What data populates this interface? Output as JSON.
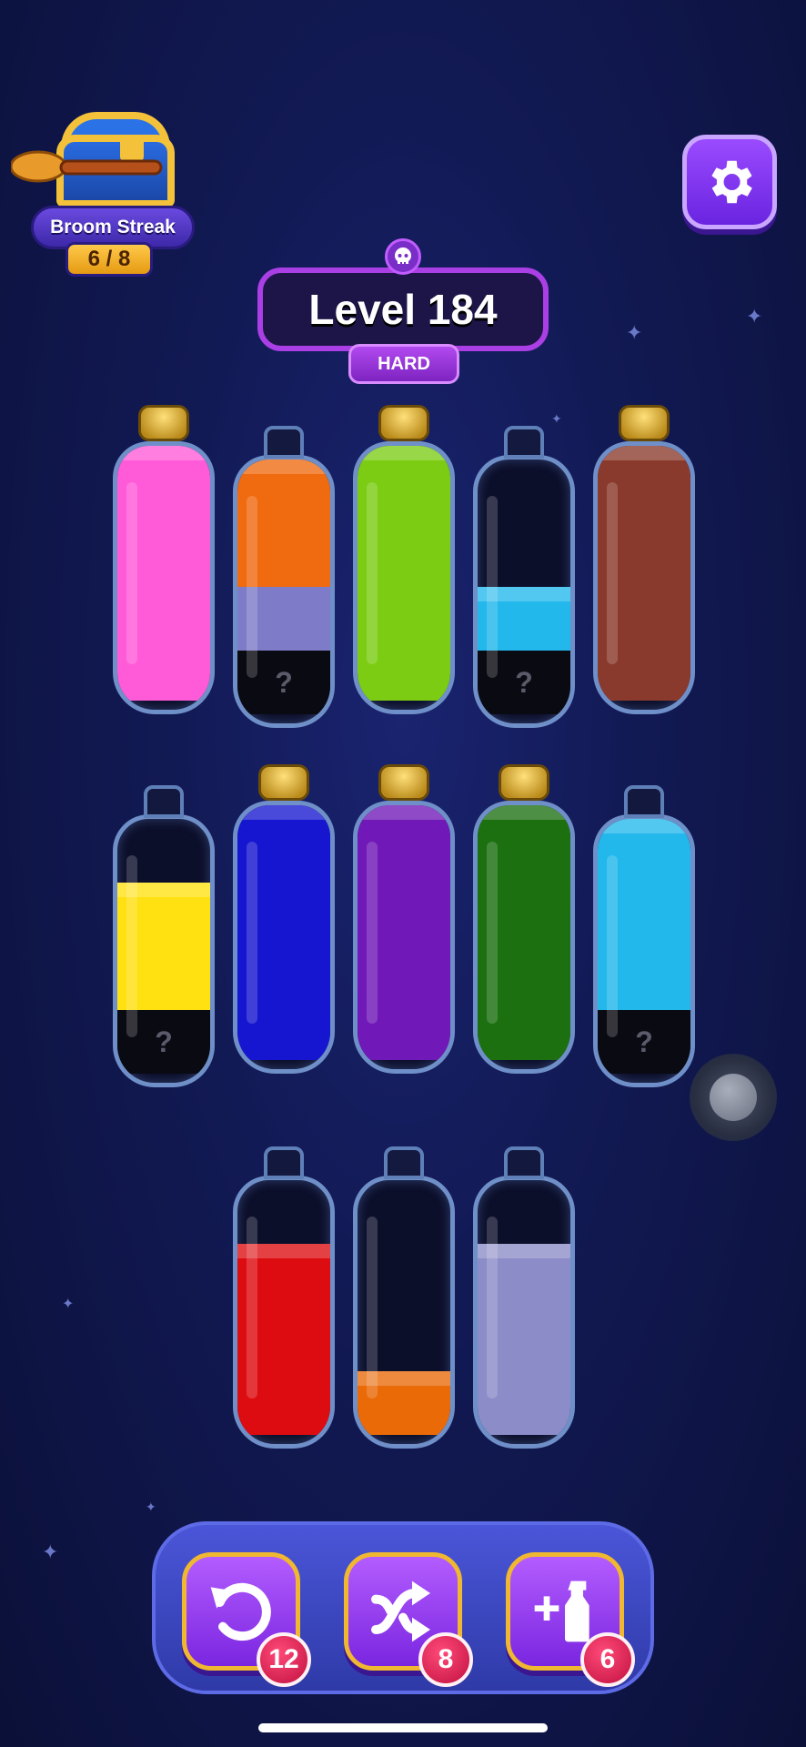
{
  "streak": {
    "label": "Broom Streak",
    "count": "6 / 8"
  },
  "level": {
    "title": "Level 184",
    "difficulty": "HARD"
  },
  "hidden_mark": "?",
  "tubes": [
    {
      "cork": true,
      "segments": [
        {
          "color": "#ff5ad8",
          "units": 4
        }
      ]
    },
    {
      "cork": false,
      "segments": [
        {
          "hidden": true
        },
        {
          "color": "#7e7cc8",
          "units": 1
        },
        {
          "color": "#f06a10",
          "units": 2
        }
      ]
    },
    {
      "cork": true,
      "segments": [
        {
          "color": "#7ccc14",
          "units": 4
        }
      ]
    },
    {
      "cork": false,
      "segments": [
        {
          "hidden": true
        },
        {
          "color": "#22b8ec",
          "units": 1
        }
      ]
    },
    {
      "cork": true,
      "segments": [
        {
          "color": "#8a3a2c",
          "units": 4
        }
      ]
    },
    {
      "cork": false,
      "segments": [
        {
          "hidden": true
        },
        {
          "color": "#ffe010",
          "units": 2
        }
      ]
    },
    {
      "cork": true,
      "segments": [
        {
          "color": "#1616d0",
          "units": 4
        }
      ]
    },
    {
      "cork": true,
      "segments": [
        {
          "color": "#7018b8",
          "units": 4
        }
      ]
    },
    {
      "cork": true,
      "segments": [
        {
          "color": "#1c7010",
          "units": 4
        }
      ]
    },
    {
      "cork": false,
      "segments": [
        {
          "hidden": true
        },
        {
          "color": "#22b8ec",
          "units": 3
        }
      ]
    },
    {
      "cork": false,
      "segments": [
        {
          "color": "#dd0c10",
          "units": 3
        }
      ]
    },
    {
      "cork": false,
      "segments": [
        {
          "color": "#ea6a08",
          "units": 1
        }
      ]
    },
    {
      "cork": false,
      "segments": [
        {
          "color": "#8c8cc8",
          "units": 3
        }
      ]
    }
  ],
  "powerups": [
    {
      "name": "undo",
      "icon": "undo-icon",
      "count": "12"
    },
    {
      "name": "shuffle",
      "icon": "shuffle-icon",
      "count": "8"
    },
    {
      "name": "add-tube",
      "icon": "add-bottle-icon",
      "count": "6"
    }
  ]
}
